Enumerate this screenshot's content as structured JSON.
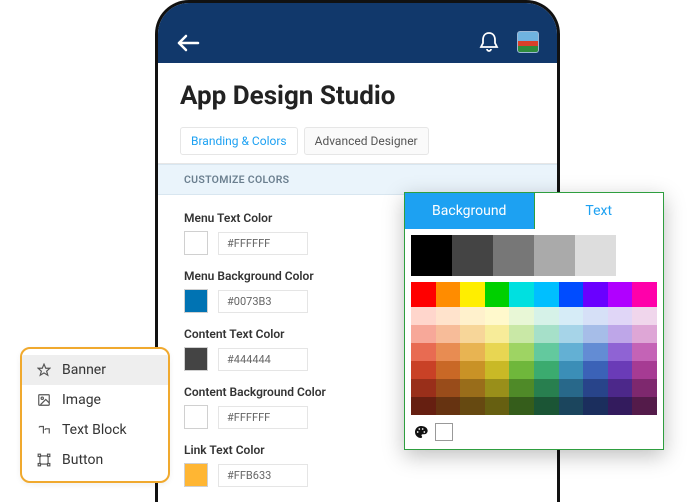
{
  "header": {
    "back_icon": "back-arrow-icon",
    "bell_icon": "bell-icon",
    "avatar": "user-avatar"
  },
  "page": {
    "title": "App Design Studio"
  },
  "tabs": [
    {
      "label": "Branding & Colors",
      "active": true
    },
    {
      "label": "Advanced Designer",
      "active": false
    }
  ],
  "section": {
    "heading": "CUSTOMIZE COLORS"
  },
  "color_fields": [
    {
      "label": "Menu Text Color",
      "hex": "#FFFFFF",
      "swatch": "#FFFFFF"
    },
    {
      "label": "Menu Background Color",
      "hex": "#0073B3",
      "swatch": "#0073B3"
    },
    {
      "label": "Content Text Color",
      "hex": "#444444",
      "swatch": "#444444"
    },
    {
      "label": "Content Background Color",
      "hex": "#FFFFFF",
      "swatch": "#FFFFFF"
    },
    {
      "label": "Link Text Color",
      "hex": "#FFB633",
      "swatch": "#FFB633"
    }
  ],
  "element_picker": {
    "items": [
      {
        "icon": "star-icon",
        "label": "Banner",
        "selected": true
      },
      {
        "icon": "image-icon",
        "label": "Image",
        "selected": false
      },
      {
        "icon": "text-icon",
        "label": "Text Block",
        "selected": false
      },
      {
        "icon": "bounding-box-icon",
        "label": "Button",
        "selected": false
      }
    ]
  },
  "color_popover": {
    "tabs": {
      "background": "Background",
      "text": "Text",
      "active": "background"
    },
    "base_row": [
      "#000000",
      "#444444",
      "#777777",
      "#aaaaaa",
      "#dddddd",
      "#ffffff"
    ],
    "hue_row": [
      "#ff0000",
      "#ff8c00",
      "#ffee00",
      "#00d000",
      "#00e0e0",
      "#00bfff",
      "#004cff",
      "#6a00ff",
      "#b000ff",
      "#ff00aa"
    ],
    "shade_rows": [
      [
        "#ffd6cc",
        "#ffe3cc",
        "#fff1cc",
        "#fff9cc",
        "#e8f7d6",
        "#d6f2e8",
        "#d6ecf7",
        "#d6e0f7",
        "#e0d6f7",
        "#f0d6ec"
      ],
      [
        "#f7a899",
        "#f7bc99",
        "#f7d699",
        "#f7ec99",
        "#c9e8a6",
        "#a6e0c9",
        "#a6d4e8",
        "#a6bde8",
        "#bea6e8",
        "#dea6d6"
      ],
      [
        "#e86b52",
        "#e88c52",
        "#e8b452",
        "#e8d652",
        "#9ed463",
        "#63c99e",
        "#63b0d4",
        "#638cd4",
        "#8f63d4",
        "#c463b6"
      ],
      [
        "#c94126",
        "#c96826",
        "#c99226",
        "#c9b926",
        "#6fb73b",
        "#3bab6f",
        "#3b8eb7",
        "#3b62b7",
        "#6a3bb7",
        "#a63b93"
      ],
      [
        "#992f1a",
        "#994c1a",
        "#996d1a",
        "#998f1a",
        "#4f8a28",
        "#287f4f",
        "#28688a",
        "#28448a",
        "#4c288a",
        "#7e286e"
      ],
      [
        "#661f11",
        "#663311",
        "#664911",
        "#665f11",
        "#355d1b",
        "#1b5535",
        "#1b455d",
        "#1b2e5d",
        "#331b5d",
        "#541b4a"
      ]
    ],
    "footer_icon": "palette-icon"
  }
}
